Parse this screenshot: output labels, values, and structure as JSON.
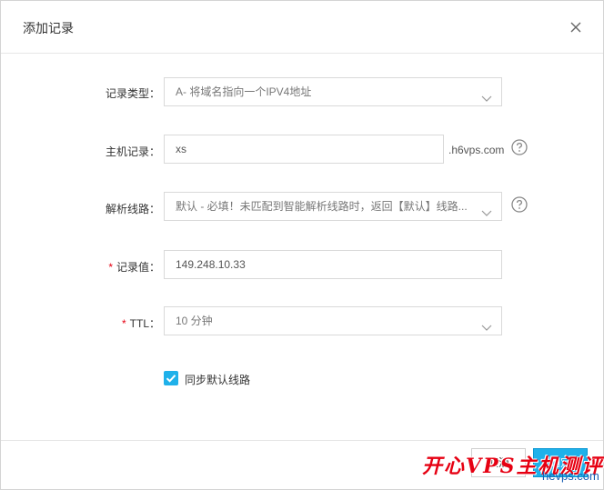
{
  "dialog": {
    "title": "添加记录"
  },
  "form": {
    "record_type": {
      "label": "记录类型：",
      "value": "A- 将域名指向一个IPV4地址"
    },
    "host": {
      "label": "主机记录：",
      "value": "xs",
      "suffix": ".h6vps.com"
    },
    "line": {
      "label": "解析线路：",
      "value": "默认 - 必填！未匹配到智能解析线路时，返回【默认】线路..."
    },
    "value": {
      "required_mark": "*",
      "label": "记录值：",
      "value": "149.248.10.33"
    },
    "ttl": {
      "required_mark": "*",
      "label": "TTL：",
      "value": "10 分钟"
    },
    "sync": {
      "label": "同步默认线路",
      "checked": true
    }
  },
  "footer": {
    "cancel_label": "取消",
    "ok_label": "确定"
  },
  "watermark": {
    "text": "开心VPS主机测评",
    "url": "hevps.com"
  },
  "colors": {
    "accent": "#1fb1ea",
    "required": "#e60012",
    "border": "#d9d9d9"
  },
  "icons": {
    "close": "close-icon",
    "chevron": "chevron-down-icon",
    "help": "question-circle-icon",
    "check": "check-icon"
  }
}
